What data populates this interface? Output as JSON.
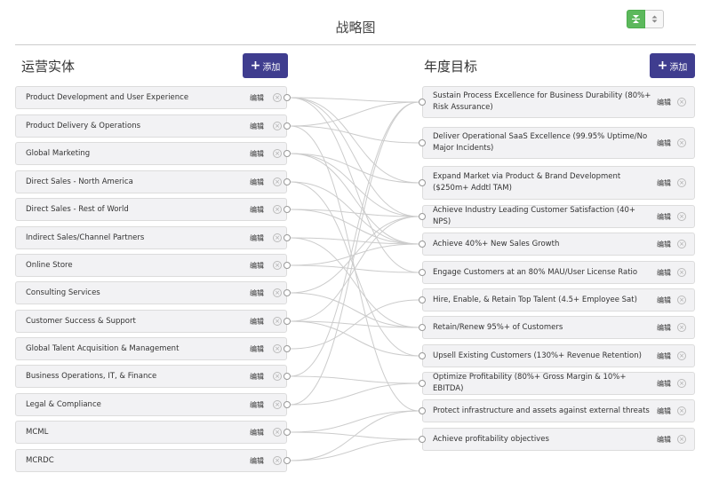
{
  "header": {
    "title": "战略图",
    "toggle_active_icon": "collapse-vertical-icon",
    "toggle_inactive_icon": "sort-icon"
  },
  "colors": {
    "accent": "#3f3d8f",
    "toggle_active": "#5cb85c",
    "link": "#cccccc"
  },
  "left": {
    "title": "运营实体",
    "add_label": "添加",
    "items": [
      {
        "label": "Product Development and User Experience",
        "edit": "编辑"
      },
      {
        "label": "Product Delivery & Operations",
        "edit": "编辑"
      },
      {
        "label": "Global Marketing",
        "edit": "编辑"
      },
      {
        "label": "Direct Sales - North America",
        "edit": "编辑"
      },
      {
        "label": "Direct Sales - Rest of World",
        "edit": "编辑"
      },
      {
        "label": "Indirect Sales/Channel Partners",
        "edit": "编辑"
      },
      {
        "label": "Online Store",
        "edit": "编辑"
      },
      {
        "label": "Consulting Services",
        "edit": "编辑"
      },
      {
        "label": "Customer Success & Support",
        "edit": "编辑"
      },
      {
        "label": "Global Talent Acquisition & Management",
        "edit": "编辑"
      },
      {
        "label": "Business Operations, IT, & Finance",
        "edit": "编辑"
      },
      {
        "label": "Legal & Compliance",
        "edit": "编辑"
      },
      {
        "label": "MCML",
        "edit": "编辑"
      },
      {
        "label": "MCRDC",
        "edit": "编辑"
      }
    ]
  },
  "right": {
    "title": "年度目标",
    "add_label": "添加",
    "items": [
      {
        "label": "Sustain Process Excellence for Business Durability (80%+ Risk Assurance)",
        "edit": "编辑"
      },
      {
        "label": "Deliver Operational SaaS Excellence (99.95% Uptime/No Major Incidents)",
        "edit": "编辑"
      },
      {
        "label": "Expand Market via Product & Brand Development ($250m+ Addtl TAM)",
        "edit": "编辑"
      },
      {
        "label": "Achieve Industry Leading Customer Satisfaction (40+ NPS)",
        "edit": "编辑"
      },
      {
        "label": "Achieve 40%+ New Sales Growth",
        "edit": "编辑"
      },
      {
        "label": "Engage Customers at an 80% MAU/User License Ratio",
        "edit": "编辑"
      },
      {
        "label": "Hire, Enable, & Retain Top Talent (4.5+ Employee Sat)",
        "edit": "编辑"
      },
      {
        "label": "Retain/Renew 95%+ of Customers",
        "edit": "编辑"
      },
      {
        "label": "Upsell Existing Customers (130%+ Revenue Retention)",
        "edit": "编辑"
      },
      {
        "label": "Optimize Profitability (80%+ Gross Margin & 10%+ EBITDA)",
        "edit": "编辑"
      },
      {
        "label": "Protect infrastructure and assets against external threats",
        "edit": "编辑"
      },
      {
        "label": "Achieve profitability objectives",
        "edit": "编辑"
      }
    ]
  },
  "links": [
    [
      0,
      0
    ],
    [
      0,
      2
    ],
    [
      0,
      3
    ],
    [
      0,
      5
    ],
    [
      1,
      1
    ],
    [
      1,
      0
    ],
    [
      1,
      10
    ],
    [
      2,
      2
    ],
    [
      2,
      4
    ],
    [
      2,
      3
    ],
    [
      3,
      4
    ],
    [
      3,
      8
    ],
    [
      4,
      4
    ],
    [
      4,
      3
    ],
    [
      5,
      4
    ],
    [
      5,
      7
    ],
    [
      6,
      5
    ],
    [
      6,
      4
    ],
    [
      7,
      3
    ],
    [
      7,
      7
    ],
    [
      8,
      3
    ],
    [
      8,
      7
    ],
    [
      8,
      8
    ],
    [
      9,
      6
    ],
    [
      10,
      9
    ],
    [
      10,
      0
    ],
    [
      11,
      0
    ],
    [
      11,
      9
    ],
    [
      12,
      11
    ],
    [
      12,
      10
    ],
    [
      13,
      11
    ],
    [
      13,
      10
    ]
  ]
}
